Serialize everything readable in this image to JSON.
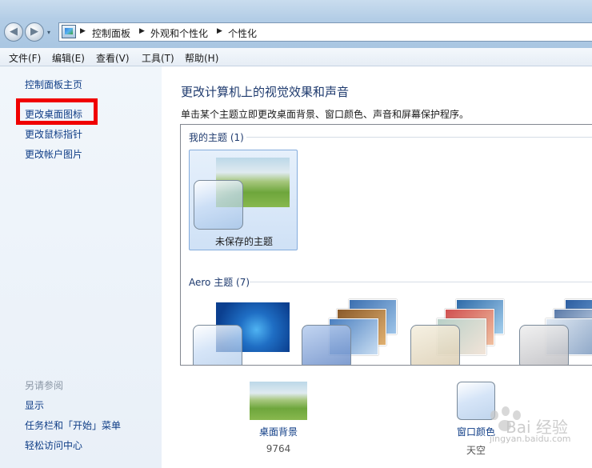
{
  "address": {
    "crumbs": [
      "控制面板",
      "外观和个性化",
      "个性化"
    ]
  },
  "menu": [
    "文件(F)",
    "编辑(E)",
    "查看(V)",
    "工具(T)",
    "帮助(H)"
  ],
  "left": {
    "home": "控制面板主页",
    "links": [
      "更改桌面图标",
      "更改鼠标指针",
      "更改帐户图片"
    ],
    "see_also": "另请参阅",
    "see_also_links": [
      "显示",
      "任务栏和「开始」菜单",
      "轻松访问中心"
    ]
  },
  "main": {
    "title": "更改计算机上的视觉效果和声音",
    "description": "单击某个主题立即更改桌面背景、窗口颜色、声音和屏幕保护程序。",
    "my_themes_label": "我的主题 (1)",
    "unsaved_theme": "未保存的主题",
    "aero_label": "Aero 主题 (7)"
  },
  "bottom": {
    "background_label": "桌面背景",
    "background_sub": "9764",
    "color_label": "窗口颜色",
    "color_sub": "天空"
  },
  "watermark": {
    "text": "Bai 经验",
    "url": "jingyan.baidu.com"
  },
  "colors": {
    "highlight": "#f00000",
    "link": "#0f3d86",
    "title": "#1e3a6e"
  }
}
